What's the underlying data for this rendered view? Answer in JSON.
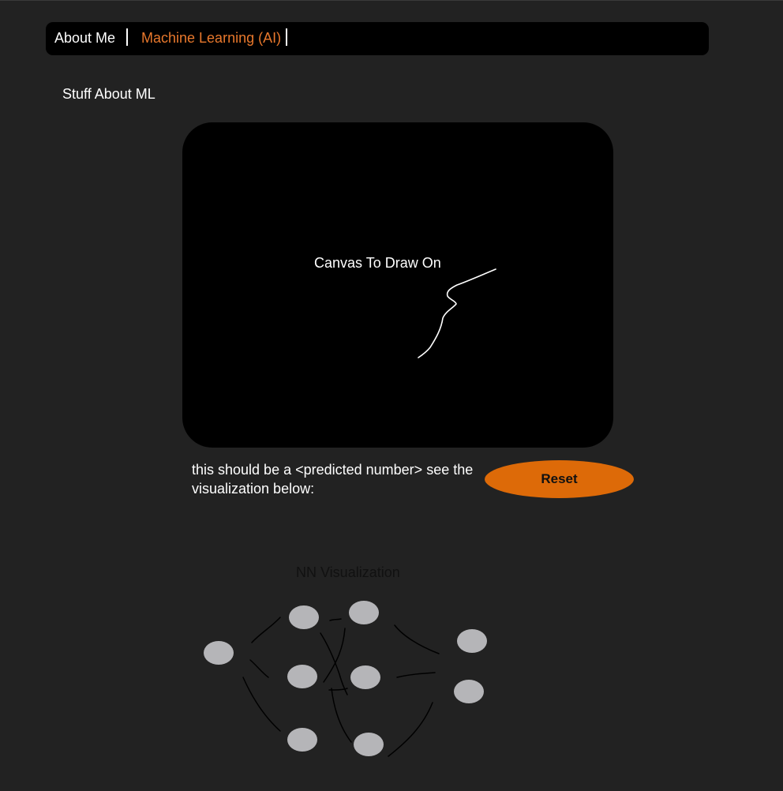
{
  "nav": {
    "items": [
      {
        "label": "About Me"
      },
      {
        "label": "Machine Learning (AI)"
      }
    ],
    "active_color": "#e8782c"
  },
  "section": {
    "title": "Stuff About ML"
  },
  "canvas": {
    "label": "Canvas To Draw On"
  },
  "prediction": {
    "text": "this should be a <predicted number> see the visualization below:"
  },
  "reset_button": {
    "label": "Reset",
    "color": "#dd6a08"
  },
  "visualization": {
    "title": "NN Visualization",
    "node_color": "#b5b5b8",
    "layers": [
      1,
      3,
      3,
      2
    ]
  }
}
